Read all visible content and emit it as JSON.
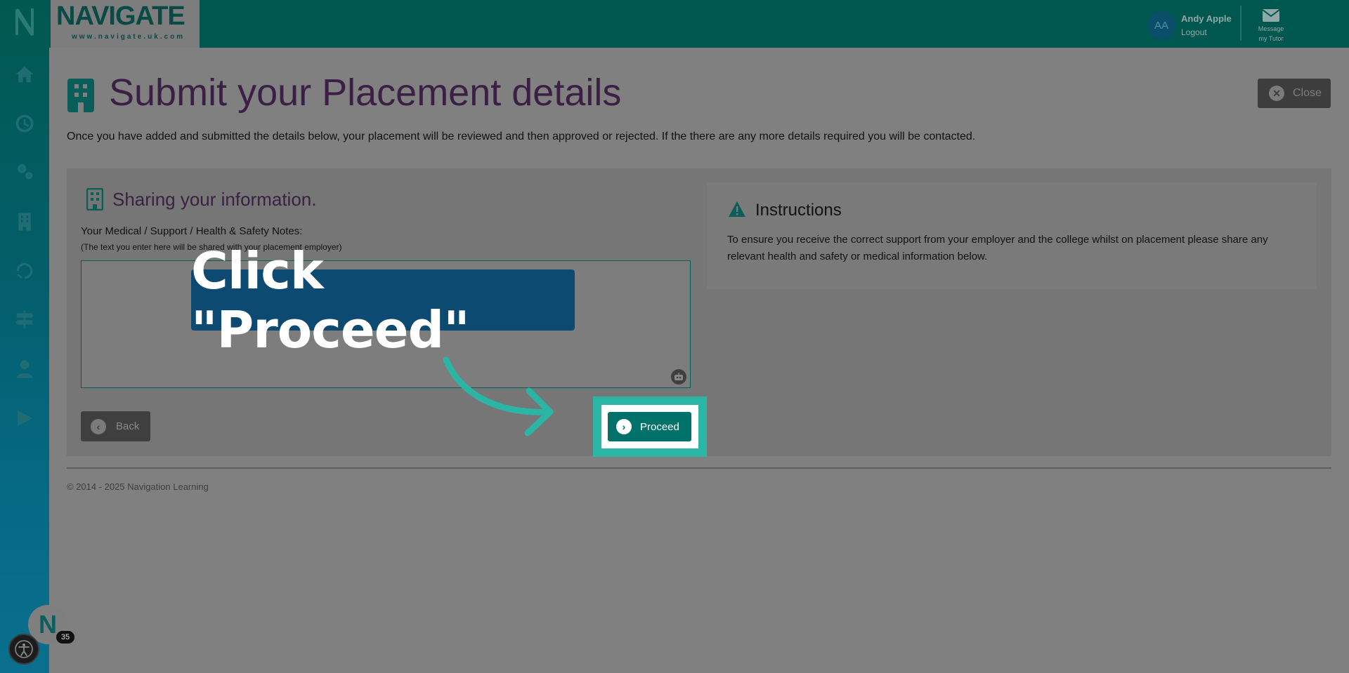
{
  "brand": {
    "name": "NAVIGATE",
    "url": "www.navigate.uk.com"
  },
  "user": {
    "initials": "AA",
    "name": "Andy Apple",
    "logout": "Logout"
  },
  "message": {
    "line1": "Message",
    "line2": "my Tutor"
  },
  "sidebar": {
    "items": [
      {
        "icon": "home-icon"
      },
      {
        "icon": "clock-icon"
      },
      {
        "icon": "gears-icon"
      },
      {
        "icon": "building-icon"
      },
      {
        "icon": "refresh-hand-icon"
      },
      {
        "icon": "signpost-icon"
      },
      {
        "icon": "user-icon"
      },
      {
        "icon": "play-icon"
      }
    ]
  },
  "page": {
    "title": "Submit your Placement details",
    "close_label": "Close",
    "intro": "Once you have added and submitted the details below, your placement will be reviewed and then approved or rejected. If the there are any more details required you will be contacted."
  },
  "sharing": {
    "title": "Sharing your information.",
    "field_label": "Your Medical / Support / Health & Safety Notes:",
    "field_hint": "(The text you enter here will be shared with your placement employer)",
    "notes_value": ""
  },
  "instructions": {
    "title": "Instructions",
    "text": "To ensure you receive the correct support from your employer and the college whilst on placement please share any relevant health and safety or medical information below."
  },
  "buttons": {
    "back": "Back",
    "proceed": "Proceed"
  },
  "callout": {
    "text": "Click \"Proceed\""
  },
  "footer": {
    "copyright": "© 2014 - 2025 Navigation Learning"
  },
  "fab": {
    "letter": "N",
    "badge": "35"
  },
  "colors": {
    "topbar": "#00574f",
    "accent": "#2bb5a5",
    "proceed": "#00726a",
    "title": "#3b1f44",
    "callout": "#0c4a72"
  }
}
